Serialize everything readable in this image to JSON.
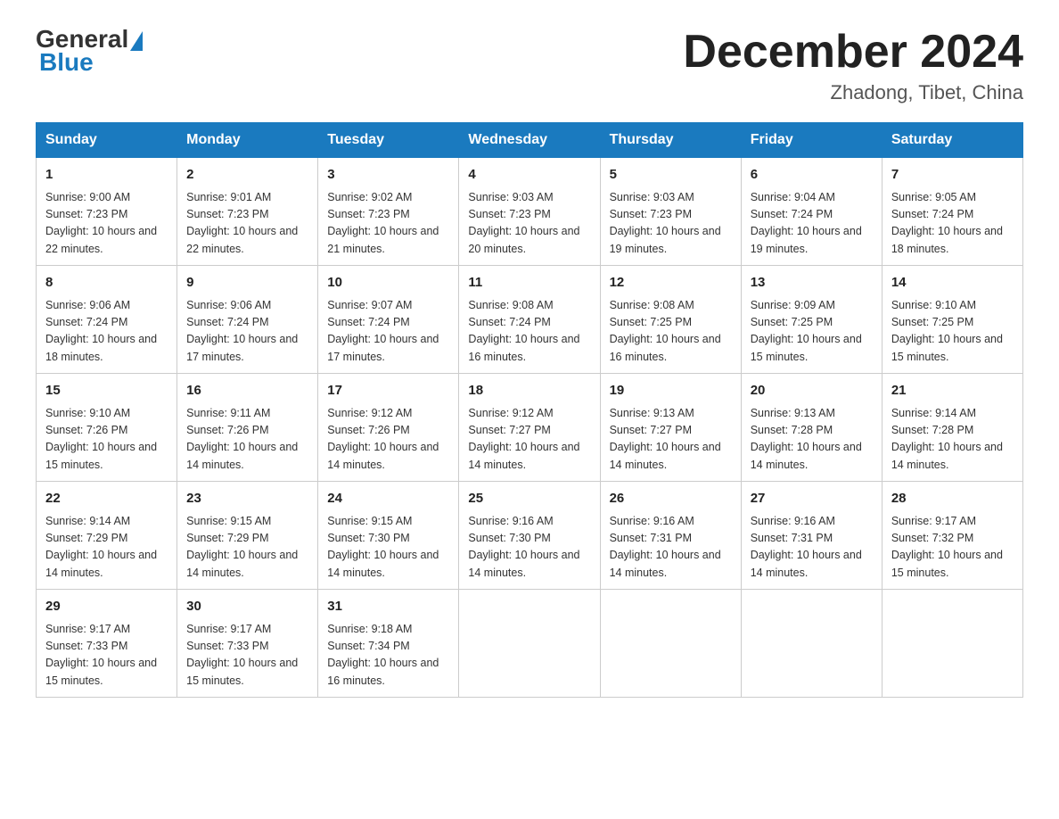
{
  "logo": {
    "general": "General",
    "blue": "Blue"
  },
  "title": {
    "month_year": "December 2024",
    "location": "Zhadong, Tibet, China"
  },
  "days_of_week": [
    "Sunday",
    "Monday",
    "Tuesday",
    "Wednesday",
    "Thursday",
    "Friday",
    "Saturday"
  ],
  "weeks": [
    [
      {
        "day": "1",
        "sunrise": "9:00 AM",
        "sunset": "7:23 PM",
        "daylight": "10 hours and 22 minutes."
      },
      {
        "day": "2",
        "sunrise": "9:01 AM",
        "sunset": "7:23 PM",
        "daylight": "10 hours and 22 minutes."
      },
      {
        "day": "3",
        "sunrise": "9:02 AM",
        "sunset": "7:23 PM",
        "daylight": "10 hours and 21 minutes."
      },
      {
        "day": "4",
        "sunrise": "9:03 AM",
        "sunset": "7:23 PM",
        "daylight": "10 hours and 20 minutes."
      },
      {
        "day": "5",
        "sunrise": "9:03 AM",
        "sunset": "7:23 PM",
        "daylight": "10 hours and 19 minutes."
      },
      {
        "day": "6",
        "sunrise": "9:04 AM",
        "sunset": "7:24 PM",
        "daylight": "10 hours and 19 minutes."
      },
      {
        "day": "7",
        "sunrise": "9:05 AM",
        "sunset": "7:24 PM",
        "daylight": "10 hours and 18 minutes."
      }
    ],
    [
      {
        "day": "8",
        "sunrise": "9:06 AM",
        "sunset": "7:24 PM",
        "daylight": "10 hours and 18 minutes."
      },
      {
        "day": "9",
        "sunrise": "9:06 AM",
        "sunset": "7:24 PM",
        "daylight": "10 hours and 17 minutes."
      },
      {
        "day": "10",
        "sunrise": "9:07 AM",
        "sunset": "7:24 PM",
        "daylight": "10 hours and 17 minutes."
      },
      {
        "day": "11",
        "sunrise": "9:08 AM",
        "sunset": "7:24 PM",
        "daylight": "10 hours and 16 minutes."
      },
      {
        "day": "12",
        "sunrise": "9:08 AM",
        "sunset": "7:25 PM",
        "daylight": "10 hours and 16 minutes."
      },
      {
        "day": "13",
        "sunrise": "9:09 AM",
        "sunset": "7:25 PM",
        "daylight": "10 hours and 15 minutes."
      },
      {
        "day": "14",
        "sunrise": "9:10 AM",
        "sunset": "7:25 PM",
        "daylight": "10 hours and 15 minutes."
      }
    ],
    [
      {
        "day": "15",
        "sunrise": "9:10 AM",
        "sunset": "7:26 PM",
        "daylight": "10 hours and 15 minutes."
      },
      {
        "day": "16",
        "sunrise": "9:11 AM",
        "sunset": "7:26 PM",
        "daylight": "10 hours and 14 minutes."
      },
      {
        "day": "17",
        "sunrise": "9:12 AM",
        "sunset": "7:26 PM",
        "daylight": "10 hours and 14 minutes."
      },
      {
        "day": "18",
        "sunrise": "9:12 AM",
        "sunset": "7:27 PM",
        "daylight": "10 hours and 14 minutes."
      },
      {
        "day": "19",
        "sunrise": "9:13 AM",
        "sunset": "7:27 PM",
        "daylight": "10 hours and 14 minutes."
      },
      {
        "day": "20",
        "sunrise": "9:13 AM",
        "sunset": "7:28 PM",
        "daylight": "10 hours and 14 minutes."
      },
      {
        "day": "21",
        "sunrise": "9:14 AM",
        "sunset": "7:28 PM",
        "daylight": "10 hours and 14 minutes."
      }
    ],
    [
      {
        "day": "22",
        "sunrise": "9:14 AM",
        "sunset": "7:29 PM",
        "daylight": "10 hours and 14 minutes."
      },
      {
        "day": "23",
        "sunrise": "9:15 AM",
        "sunset": "7:29 PM",
        "daylight": "10 hours and 14 minutes."
      },
      {
        "day": "24",
        "sunrise": "9:15 AM",
        "sunset": "7:30 PM",
        "daylight": "10 hours and 14 minutes."
      },
      {
        "day": "25",
        "sunrise": "9:16 AM",
        "sunset": "7:30 PM",
        "daylight": "10 hours and 14 minutes."
      },
      {
        "day": "26",
        "sunrise": "9:16 AM",
        "sunset": "7:31 PM",
        "daylight": "10 hours and 14 minutes."
      },
      {
        "day": "27",
        "sunrise": "9:16 AM",
        "sunset": "7:31 PM",
        "daylight": "10 hours and 14 minutes."
      },
      {
        "day": "28",
        "sunrise": "9:17 AM",
        "sunset": "7:32 PM",
        "daylight": "10 hours and 15 minutes."
      }
    ],
    [
      {
        "day": "29",
        "sunrise": "9:17 AM",
        "sunset": "7:33 PM",
        "daylight": "10 hours and 15 minutes."
      },
      {
        "day": "30",
        "sunrise": "9:17 AM",
        "sunset": "7:33 PM",
        "daylight": "10 hours and 15 minutes."
      },
      {
        "day": "31",
        "sunrise": "9:18 AM",
        "sunset": "7:34 PM",
        "daylight": "10 hours and 16 minutes."
      },
      null,
      null,
      null,
      null
    ]
  ]
}
